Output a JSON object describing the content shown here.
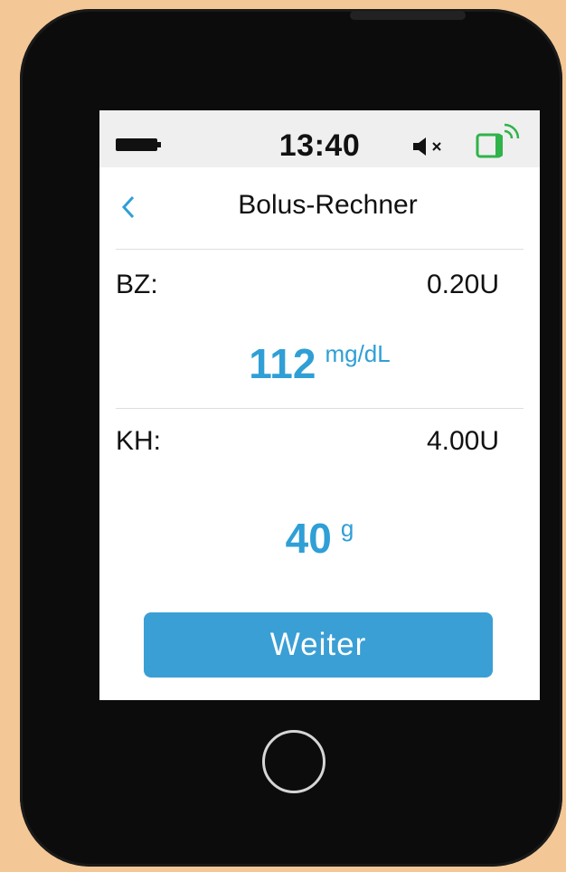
{
  "status_bar": {
    "time": "13:40",
    "icons": [
      "battery-icon",
      "speaker-muted-icon",
      "device-connected-icon"
    ]
  },
  "header": {
    "back_icon": "chevron-left-icon",
    "title": "Bolus-Rechner"
  },
  "bz": {
    "label": "BZ:",
    "units": "0.20U",
    "value": "112",
    "unit": "mg/dL"
  },
  "kh": {
    "label": "KH:",
    "units": "4.00U",
    "value": "40",
    "unit": "g"
  },
  "actions": {
    "next_label": "Weiter"
  },
  "colors": {
    "accent": "#2f9fd6",
    "button": "#3a9fd5",
    "background": "#f3c796",
    "device": "#0c0c0c",
    "connection": "#2fb34a"
  }
}
